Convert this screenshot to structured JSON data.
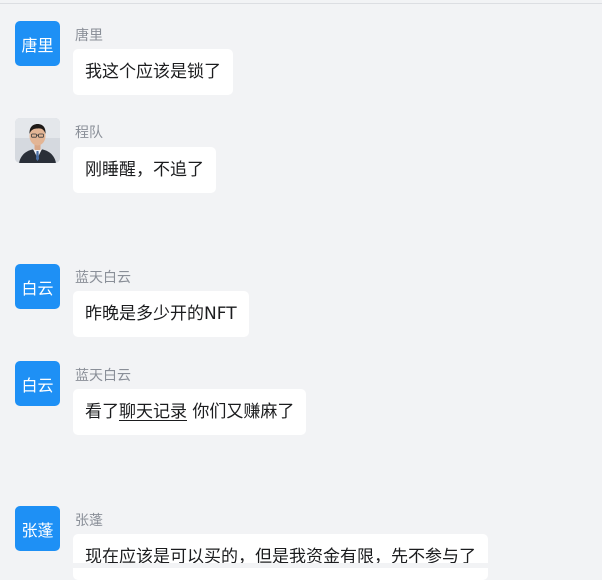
{
  "messages": [
    {
      "avatar_text": "唐里",
      "avatar_kind": "initials",
      "sender": "唐里",
      "text": "我这个应该是锁了"
    },
    {
      "avatar_text": "",
      "avatar_kind": "photo",
      "sender": "程队",
      "text": "刚睡醒，不追了"
    },
    {
      "avatar_text": "白云",
      "avatar_kind": "initials",
      "sender": "蓝天白云",
      "text": "昨晚是多少开的NFT"
    },
    {
      "avatar_text": "白云",
      "avatar_kind": "initials",
      "sender": "蓝天白云",
      "text_before": "看了",
      "link_text": "聊天记录",
      "text_after": " 你们又赚麻了"
    },
    {
      "avatar_text": "张蓬",
      "avatar_kind": "initials",
      "sender": "张蓬",
      "text": "现在应该是可以买的，但是我资金有限，先不参与了"
    }
  ],
  "colors": {
    "background": "#f2f3f5",
    "avatar_blue": "#1e90f5",
    "bubble": "#ffffff",
    "sender_name": "#8a8f98",
    "message_text": "#1b1c1e"
  },
  "icons": {
    "photo_avatar": "person-photo-icon"
  }
}
